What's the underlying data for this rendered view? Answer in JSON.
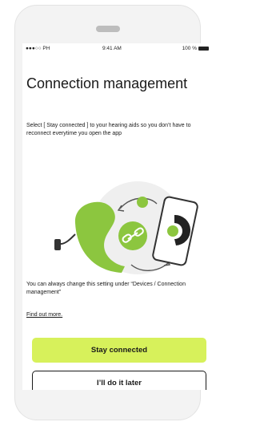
{
  "status_bar": {
    "carrier": "●●●○○ PH",
    "time": "9:41 AM",
    "battery": "100 %"
  },
  "screen": {
    "title": "Connection management",
    "intro": "Select [ Stay connected ] to your hearing aids so you don’t have to reconnect everytime you open the app",
    "note": "You can always change this setting under “Devices / Connection management”",
    "link": "Find out more.",
    "primary_button": "Stay connected",
    "secondary_button": "I’ll do it later"
  },
  "colors": {
    "accent": "#d7f15b",
    "hearing_aid": "#8cc63f",
    "link_icon": "#8cc63f"
  }
}
